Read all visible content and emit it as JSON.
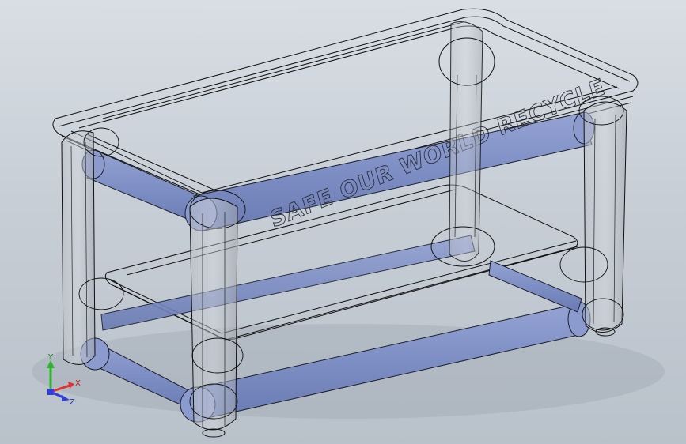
{
  "model": {
    "engraved_text": "SAFE OUR WORLD  RECYCLE"
  },
  "triad": {
    "x_label": "X",
    "y_label": "Y",
    "z_label": "Z"
  },
  "colors": {
    "background_top": "#d9dee4",
    "background_bottom": "#b9c1ca",
    "tube_fill": "#7d8ec4",
    "tube_edge": "#1b1f2a",
    "wire_edge": "#111111",
    "axis_x": "#e03030",
    "axis_y": "#2fb32f",
    "axis_z": "#2f3fd8"
  }
}
